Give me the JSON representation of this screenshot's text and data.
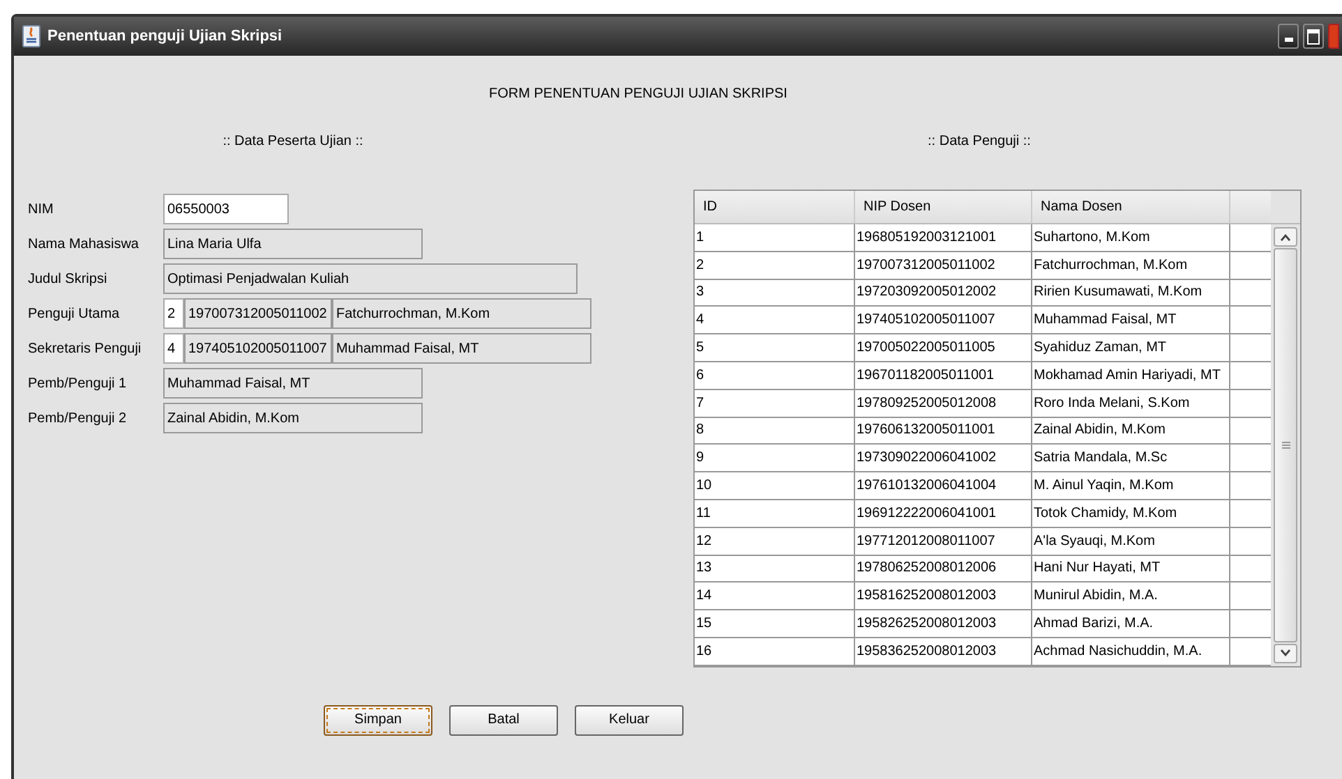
{
  "window": {
    "title": "Penentuan penguji Ujian Skripsi"
  },
  "form_title": "FORM PENENTUAN PENGUJI UJIAN SKRIPSI",
  "participant": {
    "heading": ":: Data Peserta Ujian ::",
    "fields": [
      {
        "kind": "input",
        "label": "NIM",
        "value": "06550003"
      },
      {
        "kind": "readonly",
        "label": "Nama Mahasiswa",
        "value": "Lina Maria Ulfa"
      },
      {
        "kind": "readonly_wide",
        "label": "Judul Skripsi",
        "value": "Optimasi Penjadwalan Kuliah"
      },
      {
        "kind": "examiner",
        "label": "Penguji Utama",
        "id": "2",
        "nip": "197007312005011002",
        "name": "Fatchurrochman, M.Kom"
      },
      {
        "kind": "examiner",
        "label": "Sekretaris Penguji",
        "id": "4",
        "nip": "197405102005011007",
        "name": "Muhammad Faisal, MT"
      },
      {
        "kind": "readonly",
        "label": "Pemb/Penguji 1",
        "value": "Muhammad Faisal, MT"
      },
      {
        "kind": "readonly",
        "label": "Pemb/Penguji 2",
        "value": "Zainal Abidin, M.Kom"
      }
    ]
  },
  "examiners": {
    "heading": ":: Data Penguji ::",
    "table": {
      "columns": [
        "ID",
        "NIP Dosen",
        "Nama Dosen"
      ],
      "rows": [
        [
          "1",
          "196805192003121001",
          "Suhartono, M.Kom"
        ],
        [
          "2",
          "197007312005011002",
          "Fatchurrochman, M.Kom"
        ],
        [
          "3",
          "197203092005012002",
          "Ririen Kusumawati, M.Kom"
        ],
        [
          "4",
          "197405102005011007",
          "Muhammad Faisal, MT"
        ],
        [
          "5",
          "197005022005011005",
          "Syahiduz Zaman, MT"
        ],
        [
          "6",
          "196701182005011001",
          "Mokhamad Amin Hariyadi, MT"
        ],
        [
          "7",
          "197809252005012008",
          "Roro Inda Melani, S.Kom"
        ],
        [
          "8",
          "197606132005011001",
          "Zainal Abidin, M.Kom"
        ],
        [
          "9",
          "197309022006041002",
          "Satria Mandala, M.Sc"
        ],
        [
          "10",
          "197610132006041004",
          "M. Ainul Yaqin, M.Kom"
        ],
        [
          "11",
          "196912222006041001",
          "Totok Chamidy, M.Kom"
        ],
        [
          "12",
          "197712012008011007",
          "A'la Syauqi, M.Kom"
        ],
        [
          "13",
          "197806252008012006",
          "Hani Nur Hayati, MT"
        ],
        [
          "14",
          "195816252008012003",
          "Munirul Abidin, M.A."
        ],
        [
          "15",
          "195826252008012003",
          "Ahmad Barizi, M.A."
        ],
        [
          "16",
          "195836252008012003",
          "Achmad Nasichuddin, M.A."
        ]
      ]
    }
  },
  "buttons": [
    {
      "label": "Simpan",
      "focused": true
    },
    {
      "label": "Batal",
      "focused": false
    },
    {
      "label": "Keluar",
      "focused": false
    }
  ]
}
